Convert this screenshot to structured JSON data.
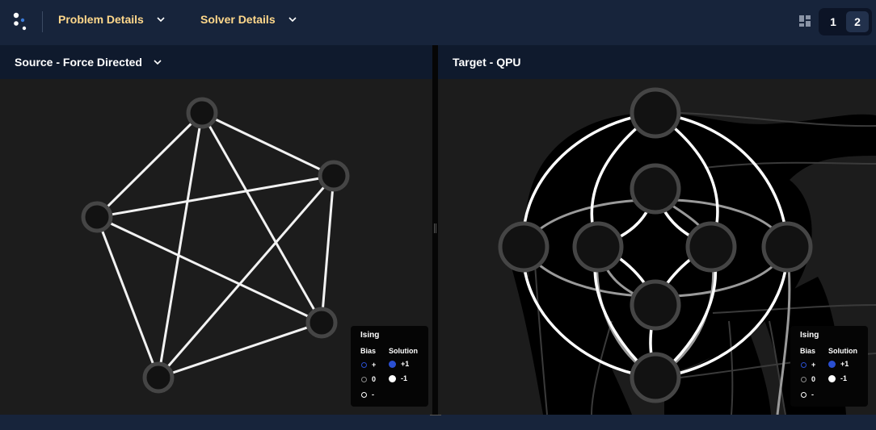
{
  "topbar": {
    "logo_icon": "app-logo-icon",
    "menus": [
      {
        "label": "Problem Details"
      },
      {
        "label": "Solver Details"
      }
    ],
    "layout_icon": "grid-layout-icon",
    "pages": [
      "1",
      "2"
    ],
    "active_page": "2"
  },
  "source_panel": {
    "title": "Source - Force Directed"
  },
  "target_panel": {
    "title": "Target - QPU"
  },
  "legend": {
    "title": "Ising",
    "bias_header": "Bias",
    "solution_header": "Solution",
    "bias_items": [
      "+",
      "0",
      "-"
    ],
    "solution_items": [
      "+1",
      "-1"
    ],
    "colors": {
      "plus": "#2a4fd1",
      "zero": "#8a8a8a",
      "minus": "#ffffff"
    }
  },
  "colors": {
    "accent": "#ffd88b",
    "header_bg": "#17243b",
    "panel_bg": "#1c1c1c"
  }
}
